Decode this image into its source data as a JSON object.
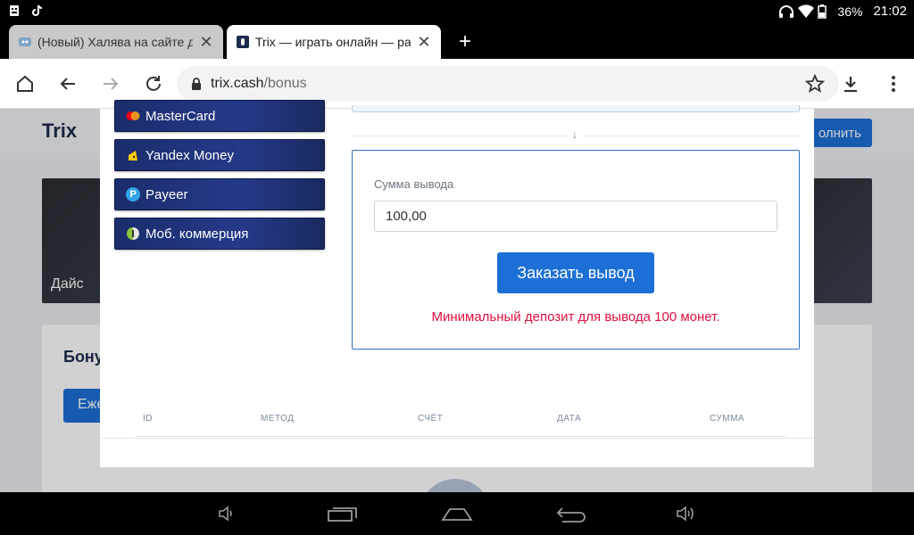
{
  "status_bar": {
    "battery": "36%",
    "time": "21:02"
  },
  "tabs": [
    {
      "title": "(Новый) Халява на сайте д",
      "active": false
    },
    {
      "title": "Trix — играть онлайн — раз",
      "active": true
    }
  ],
  "toolbar": {
    "url_host": "trix.cash",
    "url_path": "/bonus"
  },
  "page": {
    "logo": "Trix",
    "topup_label": "олнить",
    "game_card_label": "Дайс",
    "bonus_title": "Бону",
    "daily_label": "Еже"
  },
  "modal": {
    "methods": [
      {
        "label": "MasterCard",
        "icon": "mastercard-icon"
      },
      {
        "label": "Yandex Money",
        "icon": "yandex-money-icon"
      },
      {
        "label": "Payeer",
        "icon": "payeer-icon"
      },
      {
        "label": "Моб. коммерция",
        "icon": "mobile-commerce-icon"
      }
    ],
    "withdraw": {
      "label": "Сумма вывода",
      "amount": "100,00",
      "submit_label": "Заказать вывод",
      "error": "Минимальный депозит для вывода 100 монет."
    },
    "table_headers": [
      "ID",
      "МЕТОД",
      "СЧЁТ",
      "ДАТА",
      "СУММА"
    ]
  }
}
